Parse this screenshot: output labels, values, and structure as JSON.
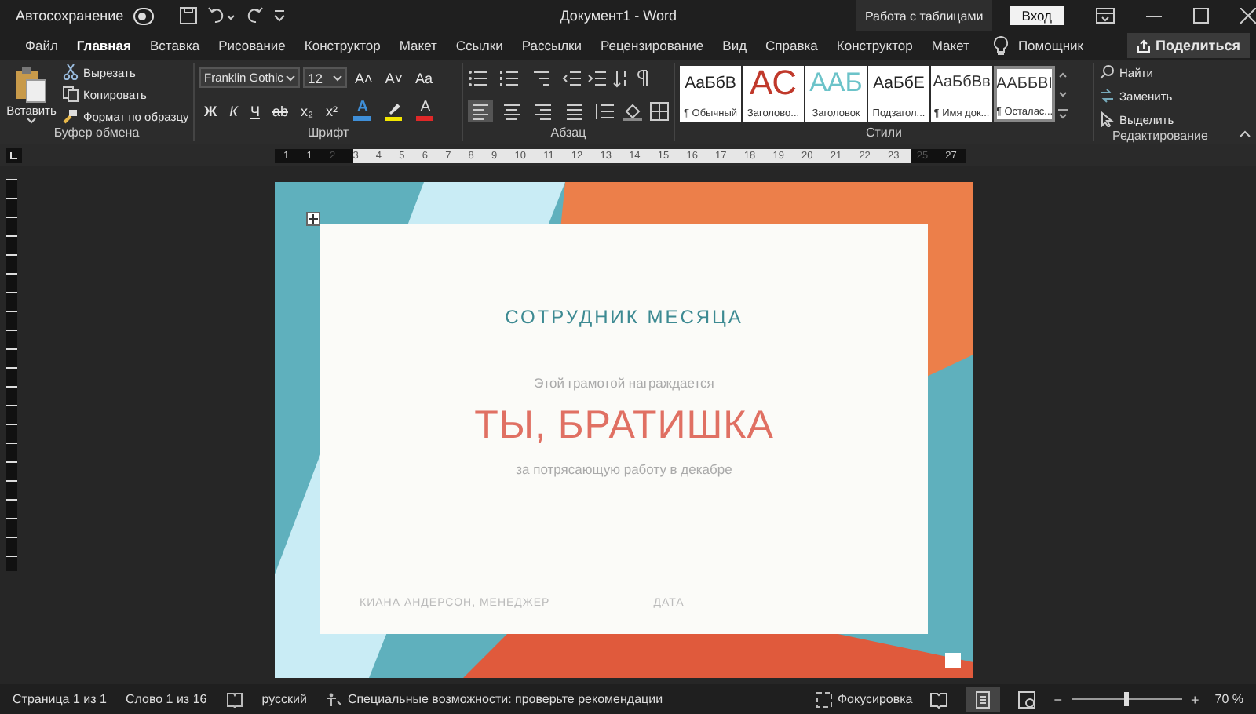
{
  "title_bar": {
    "autosave_label": "Автосохранение",
    "autosave_on": false,
    "title": "Документ1  -  Word",
    "context_tab": "Работа с таблицами",
    "sign_in": "Вход"
  },
  "tabs": [
    {
      "label": "Файл",
      "selected": false
    },
    {
      "label": "Главная",
      "selected": true
    },
    {
      "label": "Вставка",
      "selected": false
    },
    {
      "label": "Рисование",
      "selected": false
    },
    {
      "label": "Конструктор",
      "selected": false
    },
    {
      "label": "Макет",
      "selected": false
    },
    {
      "label": "Ссылки",
      "selected": false
    },
    {
      "label": "Рассылки",
      "selected": false
    },
    {
      "label": "Рецензирование",
      "selected": false
    },
    {
      "label": "Вид",
      "selected": false
    },
    {
      "label": "Справка",
      "selected": false
    },
    {
      "label": "Конструктор",
      "selected": false
    },
    {
      "label": "Макет",
      "selected": false
    }
  ],
  "assistant": "Помощник",
  "share": "Поделиться",
  "ribbon": {
    "clipboard": {
      "paste": "Вставить",
      "items": [
        "Вырезать",
        "Копировать",
        "Формат по образцу"
      ],
      "label": "Буфер обмена"
    },
    "font": {
      "name": "Franklin Gothic",
      "size": "12",
      "size_buttons": [
        "A˄",
        "A˅",
        "Aa"
      ],
      "format_buttons": [
        "Ж",
        "К",
        "Ч",
        "ab",
        "x₂",
        "x²"
      ],
      "color_buttons": [
        {
          "kind": "effects",
          "glyph": "A",
          "color": "#3f8fd8"
        },
        {
          "kind": "highlight",
          "color": "#f2e600"
        },
        {
          "kind": "font_color",
          "glyph": "A",
          "color": "#e02828"
        }
      ],
      "label": "Шрифт"
    },
    "paragraph": {
      "alignments": [
        {
          "selected": true
        },
        {
          "selected": false
        },
        {
          "selected": false
        },
        {
          "selected": false
        }
      ],
      "label": "Абзац"
    },
    "styles": {
      "items": [
        {
          "preview": "АаБбВ",
          "label": "¶ Обычный",
          "kind": "normal",
          "selected": false
        },
        {
          "preview": "АС",
          "label": "Заголово...",
          "kind": "red",
          "selected": false
        },
        {
          "preview": "ААБ",
          "label": "Заголовок",
          "kind": "teal",
          "selected": false
        },
        {
          "preview": "АаБбЕ",
          "label": "Подзагол...",
          "kind": "normal",
          "selected": false
        },
        {
          "preview": "АаБбВв",
          "label": "¶ Имя док...",
          "kind": "small",
          "selected": false
        },
        {
          "preview": "ААББВІ",
          "label": "¶ Осталас...",
          "kind": "small",
          "selected": true
        }
      ],
      "label": "Стили"
    },
    "editing": {
      "find": "Найти",
      "replace": "Заменить",
      "select": "Выделить",
      "label": "Редактирование"
    }
  },
  "ruler": [
    "1",
    "1",
    "2",
    "3",
    "4",
    "5",
    "6",
    "7",
    "8",
    "9",
    "10",
    "11",
    "12",
    "13",
    "14",
    "15",
    "16",
    "17",
    "18",
    "19",
    "20",
    "21",
    "22",
    "23",
    "25",
    "27"
  ],
  "certificate": {
    "heading": "СОТРУДНИК МЕСЯЦА",
    "intro": "Этой грамотой награждается",
    "name": "ТЫ, БРАТИШКА",
    "reason": "за потрясающую работу в декабре",
    "signature": "КИАНА АНДЕРСОН, МЕНЕДЖЕР",
    "date": "ДАТА"
  },
  "status_bar": {
    "page": "Страница 1 из 1",
    "words": "Слово 1 из 16",
    "language": "русский",
    "accessibility": "Специальные возможности: проверьте рекомендации",
    "focus": "Фокусировка",
    "views": [
      {
        "kind": "read",
        "selected": false
      },
      {
        "kind": "print",
        "selected": true
      },
      {
        "kind": "web",
        "selected": false
      }
    ],
    "zoom_out": "−",
    "zoom_in": "+",
    "zoom": {
      "level": 0.5
    },
    "zoom_label": "70 %"
  }
}
